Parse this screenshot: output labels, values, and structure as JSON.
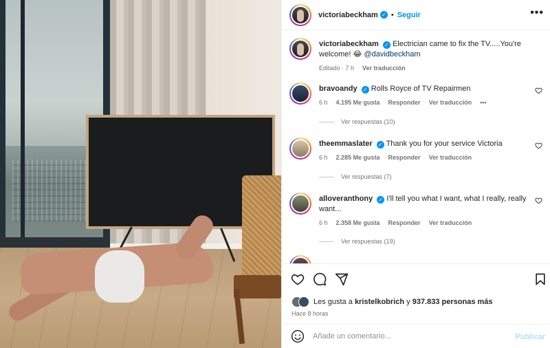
{
  "post": {
    "author": "victoriabeckham",
    "follow_label": "Seguir",
    "more_label": "•••"
  },
  "caption": {
    "user": "victoriabeckham",
    "text": "Electrician came to fix the TV.....You're welcome! 😂",
    "mention": "@davidbeckham",
    "edited": "Editado · 7 h",
    "translate": "Ver traducción"
  },
  "comments": [
    {
      "user": "bravoandy",
      "text": "Rolls Royce of TV Repairmen",
      "time": "6 h",
      "likes": "4.195 Me gusta",
      "reply": "Responder",
      "translate": "Ver traducción",
      "options": "•••",
      "replies": "Ver respuestas (10)"
    },
    {
      "user": "theemmaslater",
      "text": "Thank you for your service Victoria",
      "time": "6 h",
      "likes": "2.285 Me gusta",
      "reply": "Responder",
      "translate": "Ver traducción",
      "replies": "Ver respuestas (7)"
    },
    {
      "user": "alloveranthony",
      "text": "I'll tell you what I want, what I really, really want...",
      "time": "6 h",
      "likes": "2.358 Me gusta",
      "reply": "Responder",
      "translate": "Ver traducción",
      "replies": "Ver respuestas (19)"
    }
  ],
  "likes_line": {
    "prefix": "Les gusta a",
    "user": "kristelkobrich",
    "joiner": "y",
    "others": "937.833 personas más"
  },
  "posted_ago": "Hace 8 horas",
  "composer": {
    "placeholder": "Añade un comentario...",
    "publish": "Publicar"
  },
  "icons": [
    "heart-icon",
    "comment-icon",
    "share-icon",
    "bookmark-icon",
    "emoji-icon",
    "verified-icon",
    "more-icon"
  ],
  "colors": {
    "accent": "#0095f6",
    "verified": "#0095f6",
    "muted": "#737373",
    "text": "#262626"
  }
}
